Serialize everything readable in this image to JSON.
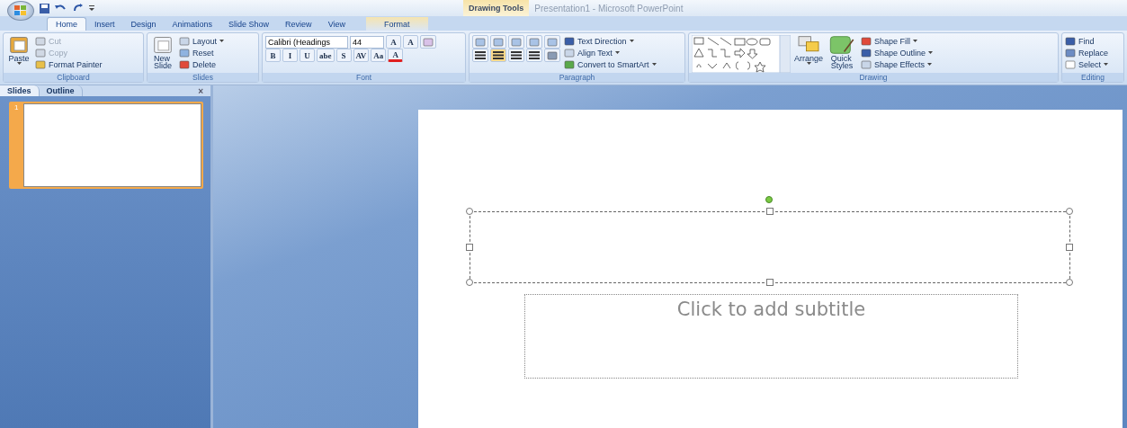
{
  "title_bar": {
    "contextual_group": "Drawing Tools",
    "title": "Presentation1 - Microsoft PowerPoint"
  },
  "tabs": [
    {
      "label": "Home",
      "selected": true,
      "contextual": false
    },
    {
      "label": "Insert",
      "selected": false,
      "contextual": false
    },
    {
      "label": "Design",
      "selected": false,
      "contextual": false
    },
    {
      "label": "Animations",
      "selected": false,
      "contextual": false
    },
    {
      "label": "Slide Show",
      "selected": false,
      "contextual": false
    },
    {
      "label": "Review",
      "selected": false,
      "contextual": false
    },
    {
      "label": "View",
      "selected": false,
      "contextual": false
    },
    {
      "label": "Format",
      "selected": false,
      "contextual": true
    }
  ],
  "clipboard": {
    "label": "Clipboard",
    "paste": "Paste",
    "items": [
      {
        "label": "Cut",
        "disabled": true
      },
      {
        "label": "Copy",
        "disabled": true
      },
      {
        "label": "Format Painter",
        "disabled": false
      }
    ]
  },
  "slides_group": {
    "label": "Slides",
    "new_slide": [
      "New",
      "Slide"
    ],
    "items": [
      "Layout",
      "Reset",
      "Delete"
    ]
  },
  "font": {
    "label": "Font",
    "face": "Calibri (Headings",
    "size": "44",
    "grow": "A",
    "shrink": "A",
    "buttons": [
      "B",
      "I",
      "U",
      "abe",
      "S",
      "AV",
      "Aa",
      "A"
    ]
  },
  "paragraph": {
    "label": "Paragraph",
    "alignments": [
      {
        "selected": false
      },
      {
        "selected": true
      },
      {
        "selected": false
      },
      {
        "selected": false
      }
    ],
    "items": [
      "Text Direction",
      "Align Text",
      "Convert to SmartArt"
    ]
  },
  "drawing": {
    "label": "Drawing",
    "arrange": "Arrange",
    "quick_styles": [
      "Quick",
      "Styles"
    ],
    "items": [
      "Shape Fill",
      "Shape Outline",
      "Shape Effects"
    ]
  },
  "editing": {
    "label": "Editing",
    "items": [
      "Find",
      "Replace",
      "Select"
    ]
  },
  "pane": {
    "tabs": [
      {
        "label": "Slides",
        "selected": true
      },
      {
        "label": "Outline",
        "selected": false
      }
    ],
    "close": "×",
    "thumbnails": [
      {
        "number": "1",
        "selected": true
      }
    ]
  },
  "slide": {
    "subtitle_placeholder": "Click to add subtitle",
    "title_selected": true
  }
}
